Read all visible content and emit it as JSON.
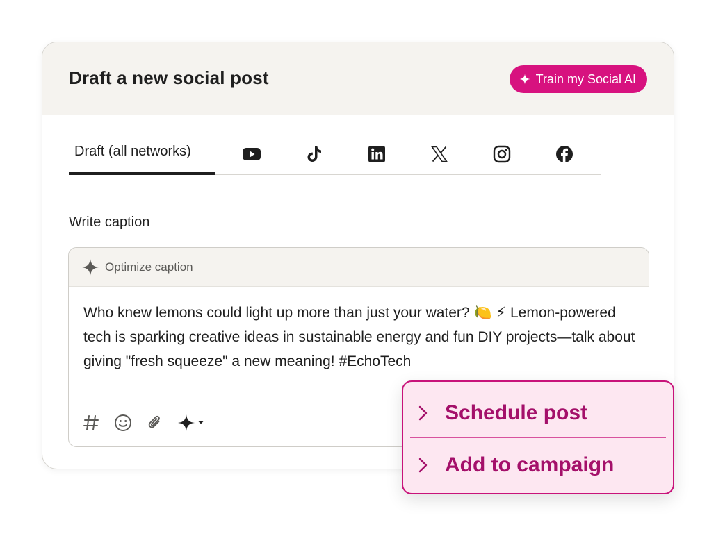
{
  "header": {
    "title": "Draft a new social post",
    "train_button_label": "Train my Social AI"
  },
  "tabs": {
    "draft_label": "Draft (all networks)",
    "networks": [
      "youtube-icon",
      "tiktok-icon",
      "linkedin-icon",
      "x-icon",
      "instagram-icon",
      "facebook-icon"
    ]
  },
  "caption": {
    "label": "Write caption",
    "optimize_label": "Optimize caption",
    "text": "Who knew lemons could light up more than just your water? 🍋 ⚡ Lemon-powered tech is sparking creative ideas in sustainable energy and fun DIY projects—talk about giving \"fresh squeeze\" a new meaning! #EchoTech"
  },
  "toolbar": {
    "icons": [
      "hashtag-icon",
      "emoji-icon",
      "attachment-icon",
      "ai-sparkle-dropdown-icon"
    ]
  },
  "popover": {
    "items": [
      {
        "label": "Schedule post"
      },
      {
        "label": "Add to campaign"
      }
    ]
  },
  "colors": {
    "accent": "#d7127f",
    "popover_text": "#a4106a",
    "popover_bg": "#fde7f1",
    "header_bg": "#f5f3ef"
  }
}
